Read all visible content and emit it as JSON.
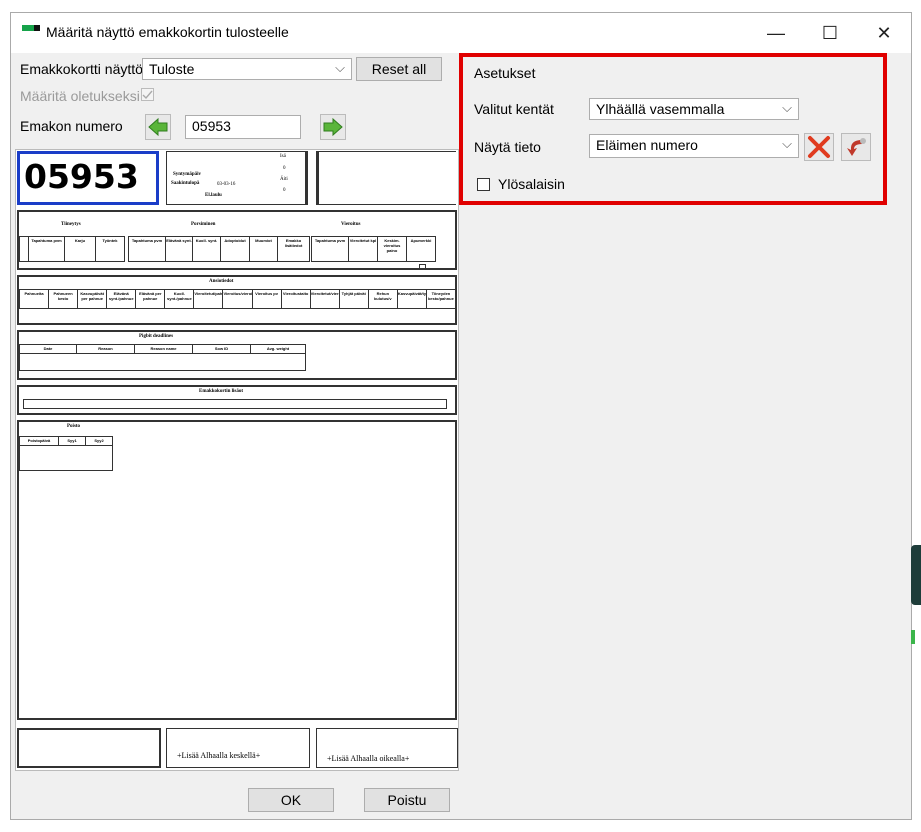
{
  "window": {
    "title": "Määritä näyttö emakkokortin tulosteelle",
    "minimize": "—",
    "maximize": "☐",
    "close": "✕"
  },
  "left": {
    "emakkokortti_label": "Emakkokortti näyttö",
    "emakkokortti_value": "Tuloste",
    "reset_label": "Reset all",
    "default_label": "Määritä oletukseksi",
    "emakon_label": "Emakon numero",
    "emakon_value": "05953"
  },
  "preview": {
    "big_number": "05953",
    "info": [
      "Syntymäpäiv",
      "Saakintulopä",
      "03-03-16",
      "El.laulu"
    ],
    "info_right": [
      "Isä",
      "0",
      "Äiti",
      "0"
    ],
    "sec1": {
      "headers": [
        "Tiineytys",
        "Porsiminen",
        "Vieroitus"
      ],
      "cols": [
        "Tapahtuma pvm",
        "Karju",
        "Työntek",
        "Tapahtuma pvm",
        "Elävänä synt.",
        "Kuoll. synt.",
        "Adoptoidut",
        "Muumiot",
        "Emakko lisätiedot",
        "Tapahtuma pvm",
        "Vieroitetut kpl",
        "Keskim. vieroitus paino",
        "Apumerkki"
      ]
    },
    "sec2": {
      "title": "Ansiotiedot",
      "cols": [
        "Pahnueita",
        "Pahnueen kesto",
        "Kasvupäivät per pahnue",
        "Elävänä synt./pahnue",
        "Elävänä per pahnue",
        "Kuoll. synt./pahnue",
        "Vieroitetut/pahnue",
        "Vieroitus/vieroitus",
        "Vieroitus pv",
        "Vieroitustaito",
        "Vieroitetut/vieroitus",
        "Tyhjät päivät",
        "Rehun kulutus/v",
        "Kasvupäivät/tyhjät",
        "Tiineyden kesto/pahnue"
      ]
    },
    "sec3": {
      "title": "Pigbit deadlines",
      "cols": [
        "Date",
        "Reason",
        "Reason name",
        "Sow ID",
        "Avg. weight"
      ]
    },
    "sec4": {
      "title": "Emakkokortin lisäot"
    },
    "sec5": {
      "title": "Poisto",
      "cols": [
        "Poistopäivä",
        "Syy1",
        "Syy2"
      ]
    },
    "footer_mid": "+Lisää Alhaalla keskellä+",
    "footer_right": "+Lisää Alhaalla oikealla+"
  },
  "settings": {
    "group_title": "Asetukset",
    "valitut_label": "Valitut kentät",
    "valitut_value": "Ylhäällä vasemmalla",
    "nayta_label": "Näytä tieto",
    "nayta_value": "Eläimen numero",
    "ylosalaisin_label": "Ylösalaisin"
  },
  "buttons": {
    "ok": "OK",
    "poistu": "Poistu"
  },
  "colors": {
    "highlight": "#e00000",
    "big_number_border": "#1a3dc8",
    "arrow_green": "#5ab53a"
  }
}
